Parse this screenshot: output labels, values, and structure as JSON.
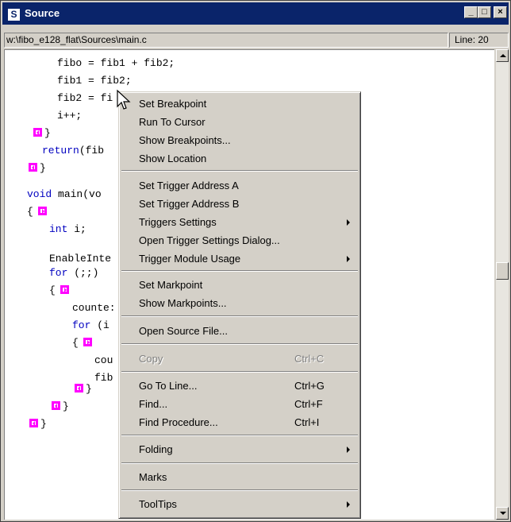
{
  "window": {
    "title": "Source",
    "app_icon_letter": "S",
    "minimize_glyph": "_",
    "maximize_glyph": "□",
    "close_glyph": "×"
  },
  "pathbar": {
    "path": "w:\\fibo_e128_flat\\Sources\\main.c",
    "line": "Line: 20"
  },
  "code": {
    "lines": [
      "fibo = fib1 + fib2;",
      "fib1 = fib2;",
      "fib2 = fi",
      "i++;",
      "}",
      "return(fib",
      "}",
      "",
      "void main(vo",
      "{",
      "int i;",
      "",
      "EnableInte",
      "for (;;)",
      "{",
      "counte:",
      "for (i",
      "{",
      "cou",
      "fib",
      "}",
      "}",
      "}"
    ],
    "line_7_void": "void",
    "line_8_main": " main(vo",
    "line_10_int": "int",
    "line_10_rest": " i;",
    "line_13_for": "for",
    "line_13_rest": " (;;)",
    "line_16_for": "for",
    "line_16_rest": " (i",
    "line_5_return": "return",
    "line_5_rest": "(fib"
  },
  "context_menu": {
    "groups": [
      [
        {
          "label": "Set Breakpoint"
        },
        {
          "label": "Run To Cursor"
        },
        {
          "label": "Show Breakpoints..."
        },
        {
          "label": "Show Location"
        }
      ],
      [
        {
          "label": "Set Trigger Address A"
        },
        {
          "label": "Set Trigger Address B"
        },
        {
          "label": "Triggers Settings",
          "submenu": true
        },
        {
          "label": "Open Trigger Settings Dialog..."
        },
        {
          "label": "Trigger Module Usage",
          "submenu": true
        }
      ],
      [
        {
          "label": "Set Markpoint"
        },
        {
          "label": "Show Markpoints..."
        }
      ],
      [
        {
          "label": "Open Source File..."
        }
      ],
      [
        {
          "label": "Copy",
          "shortcut": "Ctrl+C",
          "disabled": true
        }
      ],
      [
        {
          "label": "Go To Line...",
          "shortcut": "Ctrl+G"
        },
        {
          "label": "Find...",
          "shortcut": "Ctrl+F"
        },
        {
          "label": "Find Procedure...",
          "shortcut": "Ctrl+I"
        }
      ],
      [
        {
          "label": "Folding",
          "submenu": true
        }
      ],
      [
        {
          "label": "Marks"
        }
      ],
      [
        {
          "label": "ToolTips",
          "submenu": true
        }
      ]
    ]
  },
  "colors": {
    "titlebar": "#0a246a",
    "keyword": "#0000c0",
    "fold_marker": "#ff00ff",
    "menu_bg": "#d4d0c8"
  }
}
